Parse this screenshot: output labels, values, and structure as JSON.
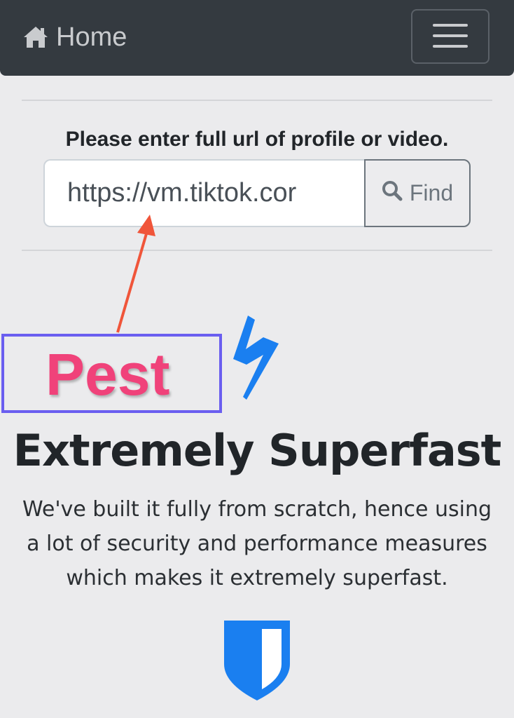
{
  "navbar": {
    "brand_label": "Home",
    "brand_icon": "home-icon",
    "toggler_icon": "hamburger-menu-icon"
  },
  "form": {
    "prompt": "Please enter full url of profile or video.",
    "url_value": "https://vm.tiktok.cor",
    "find_label": "Find",
    "find_icon": "search-icon"
  },
  "annotation": {
    "label": "Pest",
    "arrow_color": "#f0553a",
    "box_color": "#6a5ef0",
    "label_color": "#f0427a"
  },
  "feature": {
    "icon": "lightning-bolt-icon",
    "title": "Extremely Superfast",
    "text": "We've built it fully from scratch, hence using a lot of security and performance measures which makes it extremely superfast.",
    "accent_color": "#1a7ff0"
  },
  "next_feature": {
    "icon": "shield-icon"
  }
}
